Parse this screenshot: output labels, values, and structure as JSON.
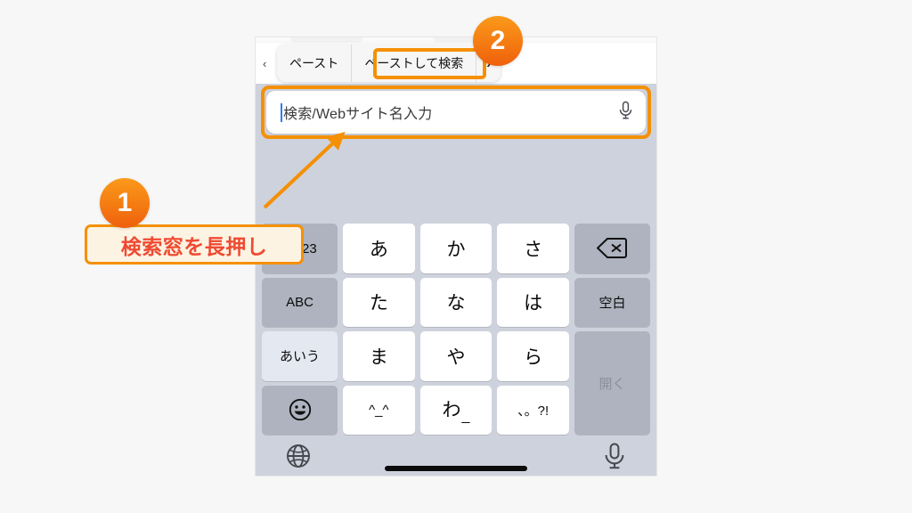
{
  "page": {
    "background": "#f7f7f7",
    "accent_orange": "#f59005",
    "callout_text_color": "#ef4a32"
  },
  "phone": {
    "context_menu": {
      "ellipsis": "‹",
      "items": [
        {
          "label": "ペースト",
          "highlighted": false
        },
        {
          "label": "ペーストして検索",
          "highlighted": true
        }
      ],
      "chevron": "›"
    },
    "search_field": {
      "placeholder": "検索/Webサイト名入力",
      "value": "",
      "mic_icon": "microphone-icon",
      "caret_color": "#2a7dff"
    },
    "keyboard": {
      "rows": [
        [
          {
            "label": "☆123",
            "style": "gray",
            "size": "small"
          },
          {
            "label": "あ",
            "style": "white",
            "size": "normal"
          },
          {
            "label": "か",
            "style": "white",
            "size": "normal"
          },
          {
            "label": "さ",
            "style": "white",
            "size": "normal"
          },
          {
            "label": "delete-icon",
            "style": "gray",
            "size": "icon"
          }
        ],
        [
          {
            "label": "ABC",
            "style": "gray",
            "size": "small"
          },
          {
            "label": "た",
            "style": "white",
            "size": "normal"
          },
          {
            "label": "な",
            "style": "white",
            "size": "normal"
          },
          {
            "label": "は",
            "style": "white",
            "size": "normal"
          },
          {
            "label": "空白",
            "style": "gray",
            "size": "small"
          }
        ],
        [
          {
            "label": "あいう",
            "style": "lite",
            "size": "small"
          },
          {
            "label": "ま",
            "style": "white",
            "size": "normal"
          },
          {
            "label": "や",
            "style": "white",
            "size": "normal"
          },
          {
            "label": "ら",
            "style": "white",
            "size": "normal"
          },
          {
            "label": "開く",
            "style": "dim",
            "size": "small"
          }
        ],
        [
          {
            "label": "emoji-icon",
            "style": "gray",
            "size": "icon"
          },
          {
            "label": "^_^",
            "style": "white",
            "size": "small"
          },
          {
            "label": "わ",
            "style": "white",
            "size": "normal"
          },
          {
            "label": "、。?!",
            "style": "white",
            "size": "small"
          }
        ]
      ],
      "wa_underscore": "_"
    },
    "bottom_bar": {
      "globe_icon": "globe-icon",
      "mic_icon": "microphone-icon",
      "home_indicator": "home-indicator"
    }
  },
  "annotations": {
    "step1": {
      "number": "1",
      "callout": "検索窓を長押し"
    },
    "step2": {
      "number": "2"
    }
  }
}
